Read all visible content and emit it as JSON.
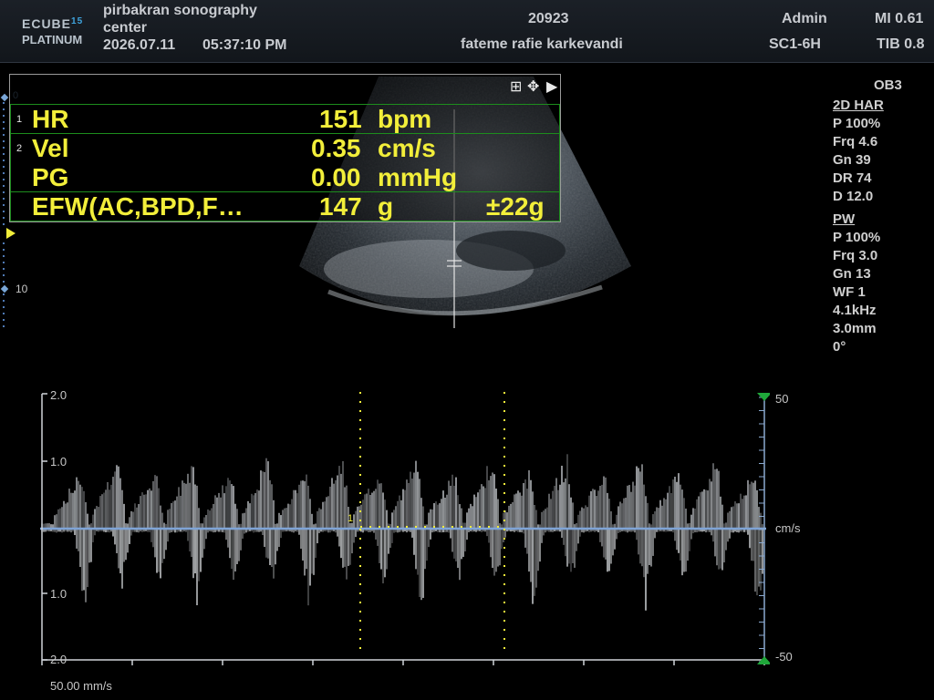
{
  "header": {
    "logo": {
      "brand": "ECUBE",
      "model_number": "15",
      "edition": "PLATINUM"
    },
    "institution_line1": "pirbakran sonography",
    "institution_line2": "center",
    "date": "2026.07.11",
    "time": "05:37:10  PM",
    "patient_id": "20923",
    "patient_name": "fateme rafie karkevandi",
    "user": "Admin",
    "probe": "SC1-6H",
    "mi": "MI 0.61",
    "tib": "TIB 0.8"
  },
  "measurements": {
    "toolbar": {
      "layout_icon": "grid-icon",
      "move_icon": "move-icon",
      "expand_icon": "triangle-right-icon"
    },
    "rows": [
      {
        "index": "1",
        "label": "HR",
        "value": "151",
        "unit": "bpm",
        "extra": ""
      },
      {
        "index": "2",
        "label": "Vel",
        "value": "0.35",
        "unit": "cm/s",
        "extra": ""
      },
      {
        "index": "",
        "label": "PG",
        "value": "0.00",
        "unit": "mmHg",
        "extra": ""
      },
      {
        "index": "",
        "label": "EFW(AC,BPD,F…",
        "value": "147",
        "unit": "g",
        "extra": "±22g"
      }
    ]
  },
  "depth_scale": {
    "marker_top": "0",
    "marker_mid": "10"
  },
  "params": {
    "preset": "OB3",
    "mode_2d": {
      "title": "2D HAR",
      "lines": [
        "P 100%",
        "Frq 4.6",
        "Gn 39",
        "DR 74",
        "D 12.0"
      ]
    },
    "mode_pw": {
      "title": "PW",
      "lines": [
        "P 100%",
        "Frq 3.0",
        "Gn 13",
        "WF 1",
        "4.1kHz",
        "3.0mm",
        "0°"
      ]
    }
  },
  "spectrum": {
    "time_labels": [
      "2.0",
      "1.0",
      "1.0",
      "2.0"
    ],
    "velocity_top": "50",
    "velocity_unit": "cm/s",
    "velocity_bottom": "-50",
    "sweep_speed": "50.00 mm/s",
    "cursor_label": "1"
  },
  "colors": {
    "accent": "#f2ee3a",
    "frame": "#1d8d1d",
    "scale": "#4f7ab5",
    "marker_green": "#1fa73a"
  }
}
